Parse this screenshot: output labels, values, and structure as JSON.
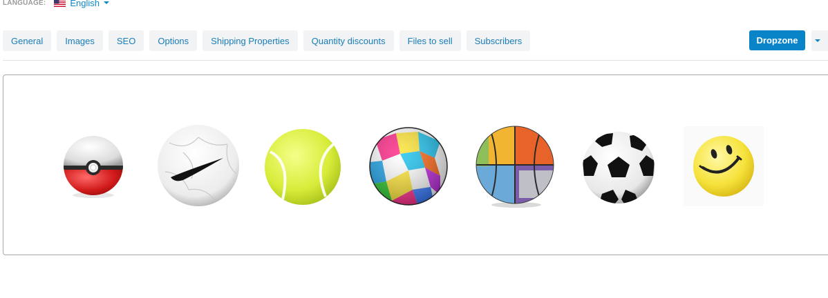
{
  "language": {
    "label": "LANGUAGE:",
    "selected": "English",
    "flag_icon": "us-flag-icon"
  },
  "tabs": [
    "General",
    "Images",
    "SEO",
    "Options",
    "Shipping Properties",
    "Quantity discounts",
    "Files to sell",
    "Subscribers"
  ],
  "toolbar": {
    "dropzone_label": "Dropzone",
    "more_icon": "caret-down-icon",
    "accent_color": "#0a84c9"
  },
  "images": [
    {
      "name": "pokeball-image"
    },
    {
      "name": "nike-soccer-ball-image"
    },
    {
      "name": "tennis-ball-image"
    },
    {
      "name": "multicolor-ball-image"
    },
    {
      "name": "multicolor-basketball-image"
    },
    {
      "name": "soccer-ball-image"
    },
    {
      "name": "smiley-ball-image"
    }
  ]
}
